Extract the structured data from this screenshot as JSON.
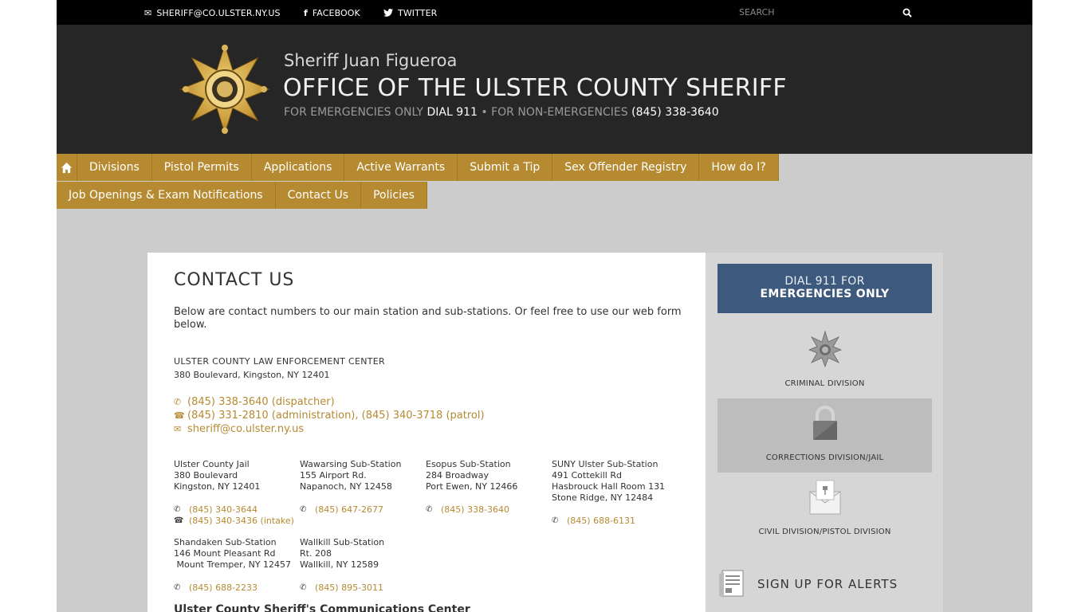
{
  "topbar": {
    "email_label": "SHERIFF@CO.ULSTER.NY.US",
    "facebook_label": "FACEBOOK",
    "twitter_label": "TWITTER",
    "search_placeholder": "SEARCH"
  },
  "header": {
    "subtitle": "Sheriff Juan Figueroa",
    "title": "OFFICE OF THE ULSTER COUNTY SHERIFF",
    "emergency_prefix": "FOR EMERGENCIES ONLY",
    "emergency_number": "DIAL 911",
    "separator": "•",
    "nonemergency_prefix": "FOR NON-EMERGENCIES",
    "nonemergency_number": "(845) 338-3640"
  },
  "nav": {
    "row1": [
      "Divisions",
      "Pistol Permits",
      "Applications",
      "Active Warrants",
      "Submit a Tip",
      "Sex Offender Registry",
      "How do I?"
    ],
    "row2": [
      "Job Openings & Exam Notifications",
      "Contact Us",
      "Policies"
    ]
  },
  "content": {
    "title": "CONTACT US",
    "intro": "Below are contact numbers to our main station and sub-stations. Or feel free to use our web form below.",
    "lec_name": "ULSTER COUNTY LAW ENFORCEMENT CENTER",
    "lec_address": "380 Boulevard, Kingston, NY 12401",
    "dispatcher": "(845) 338-3640 (dispatcher)",
    "admin_patrol": "(845) 331-2810 (administration),  (845) 340-3718 (patrol)",
    "email": "sheriff@co.ulster.ny.us",
    "stations": [
      {
        "name": "Ulster County Jail",
        "addr1": "380 Boulevard",
        "addr2": "Kingston, NY 12401",
        "addr3": "",
        "phone": "(845) 340-3644",
        "phone2": "(845) 340-3436 (intake)"
      },
      {
        "name": "Wawarsing Sub-Station",
        "addr1": "155 Airport Rd.",
        "addr2": "Napanoch, NY 12458",
        "addr3": "",
        "phone": "(845) 647-2677",
        "phone2": ""
      },
      {
        "name": "Esopus Sub-Station",
        "addr1": "284 Broadway",
        "addr2": "Port Ewen, NY 12466",
        "addr3": "",
        "phone": "(845) 338-3640",
        "phone2": ""
      },
      {
        "name": "SUNY Ulster Sub-Station",
        "addr1": "491 Cottekill Rd",
        "addr2": "Hasbrouck Hall Room 131",
        "addr3": "Stone Ridge, NY 12484",
        "phone": "(845) 688-6131",
        "phone2": ""
      },
      {
        "name": "Shandaken Sub-Station",
        "addr1": "146 Mount Pleasant Rd",
        "addr2": " Mount Tremper, NY 12457",
        "addr3": "",
        "phone": "(845) 688-2233",
        "phone2": ""
      },
      {
        "name": "Wallkill Sub-Station",
        "addr1": "Rt. 208",
        "addr2": "Wallkill, NY 12589",
        "addr3": "",
        "phone": "(845) 895-3011",
        "phone2": ""
      }
    ],
    "comm_center": "Ulster County Sheriff's Communications Center"
  },
  "sidebar": {
    "dial_line1": "DIAL 911 FOR",
    "dial_line2": "EMERGENCIES ONLY",
    "divisions": [
      {
        "label": "CRIMINAL DIVISION",
        "bg": "#d6d6d6",
        "icon": "star-badge-icon"
      },
      {
        "label": "CORRECTIONS DIVISION/JAIL",
        "bg": "#bdbdbd",
        "icon": "padlock-icon"
      },
      {
        "label": "CIVIL DIVISION/PISTOL DIVISION",
        "bg": "#d6d6d6",
        "icon": "envelope-pin-icon"
      }
    ],
    "alerts_label": "SIGN UP FOR ALERTS"
  },
  "colors": {
    "gold": "#b68a31",
    "header_bg": "#262626",
    "dial_blue": "#3d5a7e",
    "page_bg": "#cccccc"
  }
}
